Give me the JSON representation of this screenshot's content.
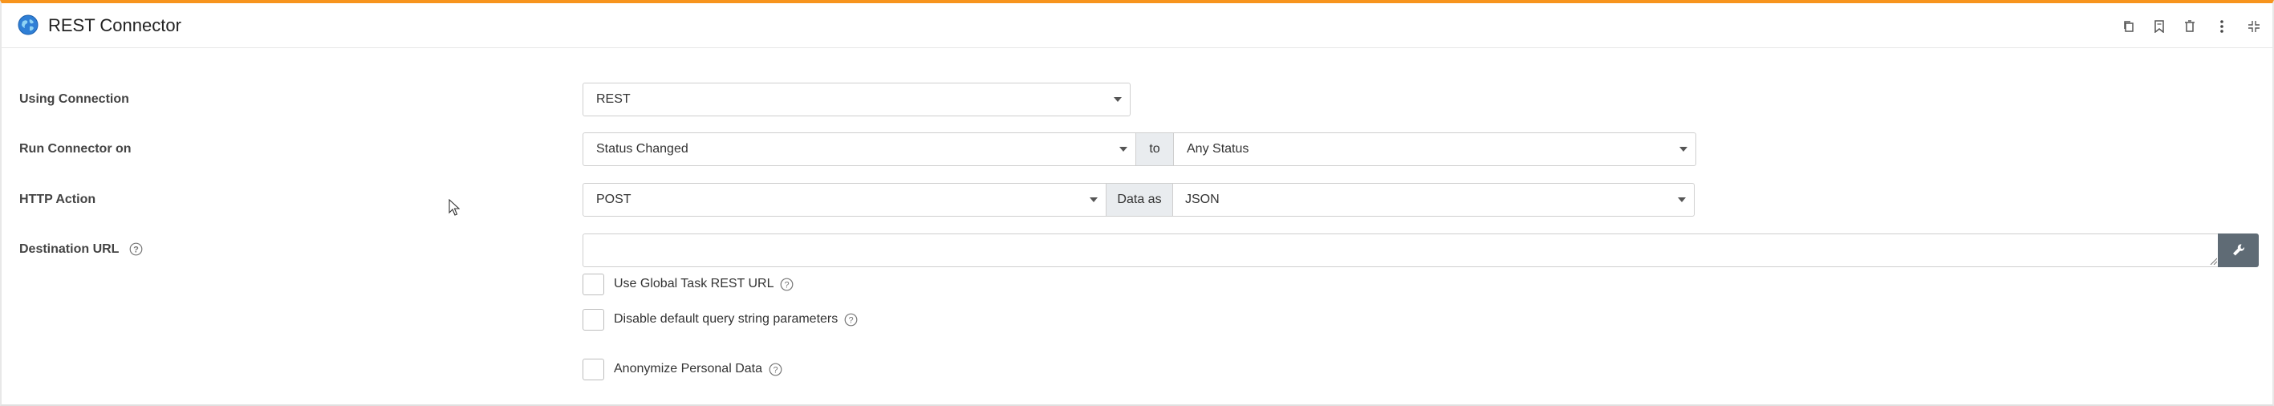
{
  "panel": {
    "title": "REST Connector",
    "header_icons": [
      "copy-icon",
      "bookmark-icon",
      "delete-icon",
      "more-vertical-icon",
      "collapse-icon"
    ]
  },
  "form": {
    "connection": {
      "label": "Using Connection",
      "value": "REST"
    },
    "run_connector": {
      "label": "Run Connector on",
      "trigger_value": "Status Changed",
      "to_label": "to",
      "status_value": "Any Status"
    },
    "http_action": {
      "label": "HTTP Action",
      "method_value": "POST",
      "data_as_label": "Data as",
      "format_value": "JSON"
    },
    "destination_url": {
      "label": "Destination URL",
      "value": ""
    },
    "options": {
      "use_global_url": {
        "label": "Use Global Task REST URL",
        "checked": false
      },
      "disable_query_params": {
        "label": "Disable default query string parameters",
        "checked": false
      },
      "anonymize": {
        "label": "Anonymize Personal Data",
        "checked": false
      }
    }
  },
  "colors": {
    "accent": "#f7941d",
    "wrench_button": "#5f6b75",
    "addon_bg": "#e9ecef"
  }
}
